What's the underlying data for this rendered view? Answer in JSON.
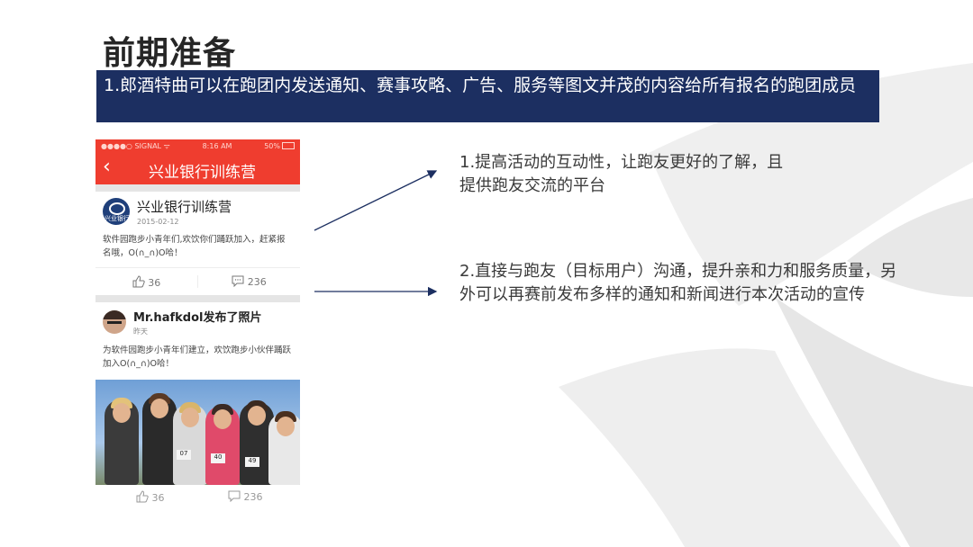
{
  "slide": {
    "title": "前期准备",
    "banner_text": "1.郎酒特曲可以在跑团内发送通知、赛事攻略、广告、服务等图文并茂的内容给所有报名的跑团成员",
    "accent_color": "#1c2f61"
  },
  "phone": {
    "status": {
      "carrier": "●●●●○ SIGNAL ᯤ",
      "time": "8:16 AM",
      "battery": "50%"
    },
    "nav": {
      "back_icon": "‹",
      "title": "兴业银行训练营",
      "color": "#ef3d2f"
    },
    "posts": [
      {
        "author": "兴业银行训练营",
        "date": "2015-02-12",
        "avatar_text": "兴业银行",
        "text": "软件园跑步小青年们,欢饮你们踊跃加入，赶紧报名哦，O(∩_∩)O哈！",
        "likes": "36",
        "comments": "236"
      },
      {
        "author": "Mr.hafkdol发布了照片",
        "date": "昨天",
        "text": "为软件园跑步小青年们建立，欢饮跑步小伙伴踊跃加入O(∩_∩)O哈！",
        "bibs": [
          "07",
          "40",
          "49"
        ],
        "likes": "36",
        "comments": "236"
      }
    ]
  },
  "points": [
    "1.提高活动的互动性，让跑友更好的了解，且提供跑友交流的平台",
    "2.直接与跑友（目标用户）沟通，提升亲和力和服务质量，另外可以再赛前发布多样的通知和新闻进行本次活动的宣传"
  ],
  "icons": {
    "like": "thumbs-up-icon",
    "comment": "comment-icon",
    "back": "chevron-left-icon"
  }
}
